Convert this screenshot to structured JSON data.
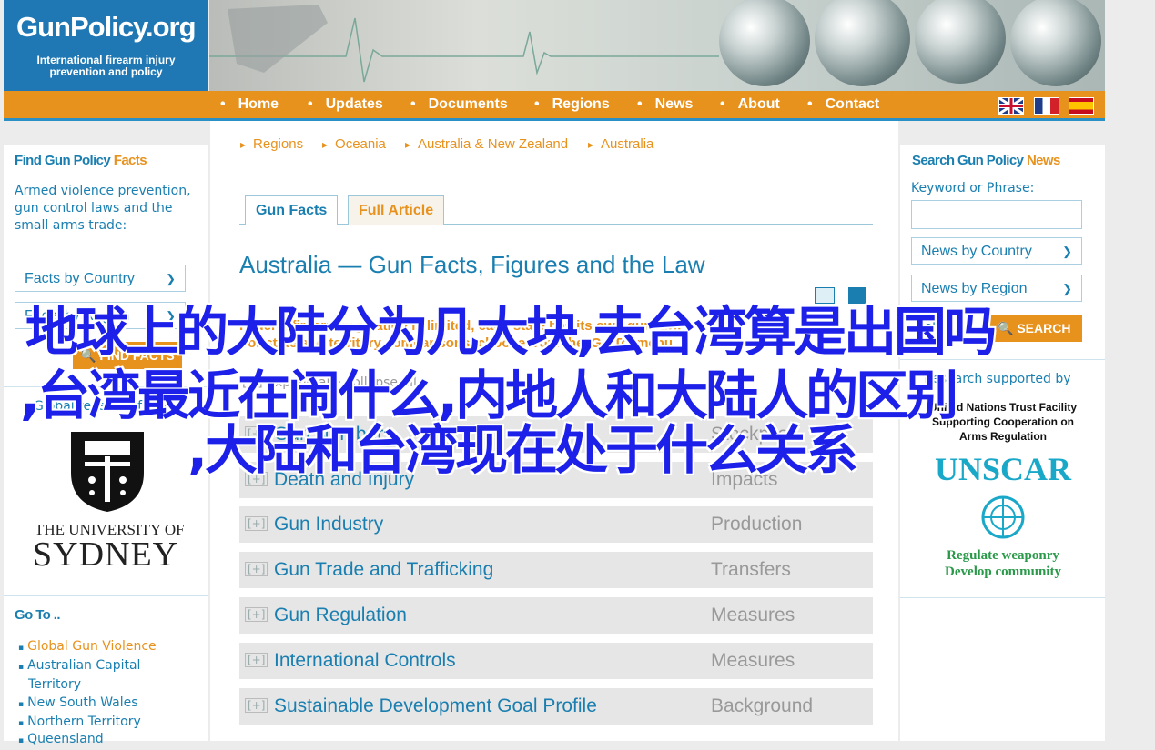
{
  "brand": {
    "title": "GunPolicy.org",
    "tagline_line1": "International firearm injury",
    "tagline_line2": "prevention and policy"
  },
  "nav": {
    "items": [
      "Home",
      "Updates",
      "Documents",
      "Regions",
      "News",
      "About",
      "Contact"
    ],
    "flags": [
      "english-flag",
      "french-flag",
      "spanish-flag"
    ]
  },
  "left": {
    "find_head_main": "Find Gun Policy",
    "find_head_accent": "Facts",
    "find_text": "Armed violence prevention, gun control laws and the small arms trade:",
    "select_country": "Facts by Country",
    "select_region": "Facts by Region",
    "find_button": "FIND FACTS",
    "research_text": "Global research from",
    "university_line1": "THE UNIVERSITY OF",
    "university_line2": "SYDNEY",
    "goto_head": "Go To ..",
    "goto_items": [
      {
        "label": "Global Gun Violence",
        "color": "#e8921e"
      },
      {
        "label": "Australian Capital Territory",
        "color": "#1a7fb0"
      },
      {
        "label": "New South Wales",
        "color": "#1a7fb0"
      },
      {
        "label": "Northern Territory",
        "color": "#1a7fb0"
      },
      {
        "label": "Queensland",
        "color": "#1a7fb0"
      }
    ]
  },
  "breadcrumb": [
    "Regions",
    "Oceania",
    "Australia & New Zealand",
    "Australia"
  ],
  "tabs": {
    "gun_facts": "Gun Facts",
    "full_article": "Full Article"
  },
  "page_title": "Australia — Gun Facts, Figures and the Law",
  "notice_line1": "Federal firearm regulation is limited, each state has its own gun law.",
  "notice_line2": "For state and territory comparisons, choose from the 'Go To' menu",
  "expand_all": "[+] Expand all  ·  collapse all",
  "sections": [
    {
      "title": "Gun Numbers",
      "category": "Stockpiles"
    },
    {
      "title": "Death and Injury",
      "category": "Impacts"
    },
    {
      "title": "Gun Industry",
      "category": "Production"
    },
    {
      "title": "Gun Trade and Trafficking",
      "category": "Transfers"
    },
    {
      "title": "Gun Regulation",
      "category": "Measures"
    },
    {
      "title": "International Controls",
      "category": "Measures"
    },
    {
      "title": "Sustainable Development Goal Profile",
      "category": "Background"
    }
  ],
  "plus_glyph": "[+]",
  "right": {
    "search_head_main": "Search Gun Policy",
    "search_head_accent": "News",
    "keyword_label": "Keyword or Phrase:",
    "keyword_placeholder": "",
    "select_country": "News by Country",
    "select_region": "News by Region",
    "help_link": "Help",
    "search_button": "SEARCH",
    "supported_text": "Research supported by",
    "un_line1": "United Nations Trust Facility",
    "un_line2": "Supporting Cooperation on",
    "un_line3": "Arms Regulation",
    "unscar": "UNSCAR",
    "slogan1": "Regulate weaponry",
    "slogan2": "Develop community"
  },
  "overlay_text": {
    "line1": "地球上的大陆分为几大块,去台湾算是出国吗",
    "line2": ",台湾最近在闹什么,内地人和大陆人的区别",
    "line3": ",大陆和台湾现在处于什么关系"
  },
  "colors": {
    "brand_blue": "#1f78b4",
    "nav_orange": "#e8921e",
    "link_blue": "#1a7fb0",
    "overlay_blue": "#1c20e8",
    "unscar_teal": "#1aa8c9",
    "slogan_green": "#2a9a4a"
  }
}
